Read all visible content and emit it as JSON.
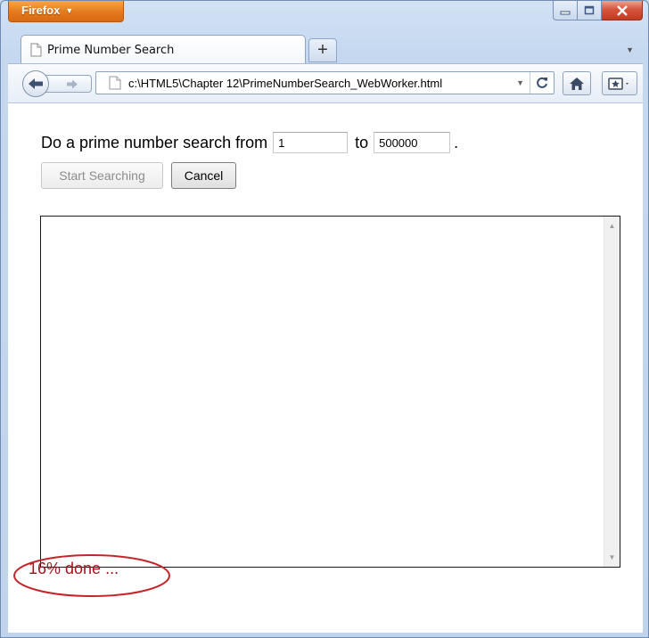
{
  "browser": {
    "menu_button_label": "Firefox",
    "tab_title": "Prime Number Search",
    "new_tab_symbol": "+",
    "url": "c:\\HTML5\\Chapter 12\\PrimeNumberSearch_WebWorker.html"
  },
  "page": {
    "prompt_text": "Do a prime number search from",
    "from_value": "1",
    "to_label": "to",
    "to_value": "500000",
    "period": ".",
    "start_button_label": "Start Searching",
    "cancel_button_label": "Cancel",
    "status_text": "16% done ..."
  },
  "colors": {
    "status_text": "#a0131c",
    "highlight_oval": "#c4242a",
    "firefox_button": "#e4791d"
  },
  "icons": [
    "firefox-menu-caret",
    "minimize-icon",
    "maximize-icon",
    "close-icon",
    "page-icon",
    "new-tab-icon",
    "back-icon",
    "forward-icon",
    "dropdown-icon",
    "reload-icon",
    "home-icon",
    "bookmarks-icon"
  ]
}
